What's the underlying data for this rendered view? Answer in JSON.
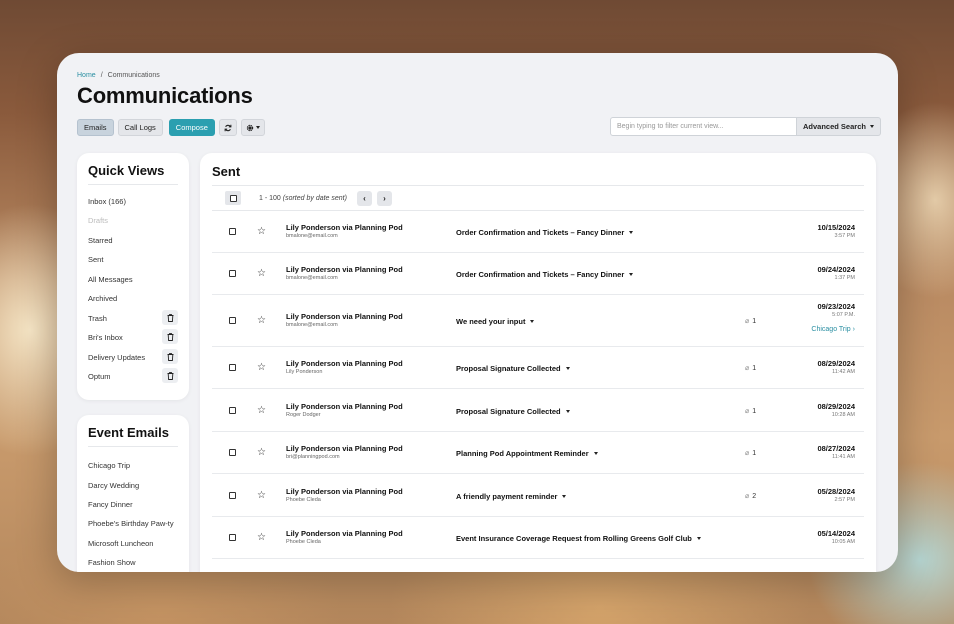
{
  "breadcrumb": {
    "home": "Home",
    "separator": "/",
    "current": "Communications"
  },
  "page_title": "Communications",
  "toolbar": {
    "emails": "Emails",
    "call_logs": "Call Logs",
    "compose": "Compose",
    "refresh_icon": "refresh-icon",
    "settings_icon": "gear-icon"
  },
  "search": {
    "placeholder": "Begin typing to filter current view...",
    "advanced": "Advanced Search"
  },
  "quick_views": {
    "title": "Quick Views",
    "items": [
      {
        "label": "Inbox (166)",
        "muted": false,
        "deletable": false
      },
      {
        "label": "Drafts",
        "muted": true,
        "deletable": false
      },
      {
        "label": "Starred",
        "muted": false,
        "deletable": false
      },
      {
        "label": "Sent",
        "muted": false,
        "deletable": false
      },
      {
        "label": "All Messages",
        "muted": false,
        "deletable": false
      },
      {
        "label": "Archived",
        "muted": false,
        "deletable": false
      },
      {
        "label": "Trash",
        "muted": false,
        "deletable": true
      },
      {
        "label": "Bri's Inbox",
        "muted": false,
        "deletable": true
      },
      {
        "label": "Delivery Updates",
        "muted": false,
        "deletable": true
      },
      {
        "label": "Optum",
        "muted": false,
        "deletable": true
      }
    ]
  },
  "event_emails": {
    "title": "Event Emails",
    "items": [
      "Chicago Trip",
      "Darcy Wedding",
      "Fancy Dinner",
      "Phoebe's Birthday Paw-ty",
      "Microsoft Luncheon",
      "Fashion Show"
    ]
  },
  "main": {
    "title": "Sent",
    "range_prefix": "1 - 100",
    "range_note": "(sorted by date sent)",
    "prev": "‹",
    "next": "›"
  },
  "messages": [
    {
      "sender": "Lily Ponderson via Planning Pod",
      "email": "bmalone@email.com",
      "subject": "Order Confirmation and Tickets – Fancy Dinner",
      "attachments": "",
      "date": "10/15/2024",
      "time": "3:57 PM",
      "tag": ""
    },
    {
      "sender": "Lily Ponderson via Planning Pod",
      "email": "bmalone@email.com",
      "subject": "Order Confirmation and Tickets – Fancy Dinner",
      "attachments": "",
      "date": "09/24/2024",
      "time": "1:37 PM",
      "tag": ""
    },
    {
      "sender": "Lily Ponderson via Planning Pod",
      "email": "bmalone@email.com",
      "subject": "We need your input",
      "attachments": "1",
      "date": "09/23/2024",
      "time": "5:07 P.M.",
      "tag": "Chicago Trip"
    },
    {
      "sender": "Lily Ponderson via Planning Pod",
      "email": "Lily Ponderson",
      "subject": "Proposal Signature Collected",
      "attachments": "1",
      "date": "08/29/2024",
      "time": "11:42 AM",
      "tag": ""
    },
    {
      "sender": "Lily Ponderson via Planning Pod",
      "email": "Roger Dodger",
      "subject": "Proposal Signature Collected",
      "attachments": "1",
      "date": "08/29/2024",
      "time": "10:28 AM",
      "tag": ""
    },
    {
      "sender": "Lily Ponderson via Planning Pod",
      "email": "bri@planningpod.com",
      "subject": "Planning Pod Appointment Reminder",
      "attachments": "1",
      "date": "08/27/2024",
      "time": "11:41 AM",
      "tag": ""
    },
    {
      "sender": "Lily Ponderson via Planning Pod",
      "email": "Phoebe Cleda",
      "subject": "A friendly payment reminder",
      "attachments": "2",
      "date": "05/28/2024",
      "time": "2:57 PM",
      "tag": ""
    },
    {
      "sender": "Lily Ponderson via Planning Pod",
      "email": "Phoebe Cleda",
      "subject": "Event Insurance Coverage Request from Rolling Greens Golf Club",
      "attachments": "",
      "date": "05/14/2024",
      "time": "10:05 AM",
      "tag": ""
    }
  ],
  "colors": {
    "accent": "#2b9fb0",
    "link": "#2a8fa2",
    "panel": "#f1f2f5"
  }
}
